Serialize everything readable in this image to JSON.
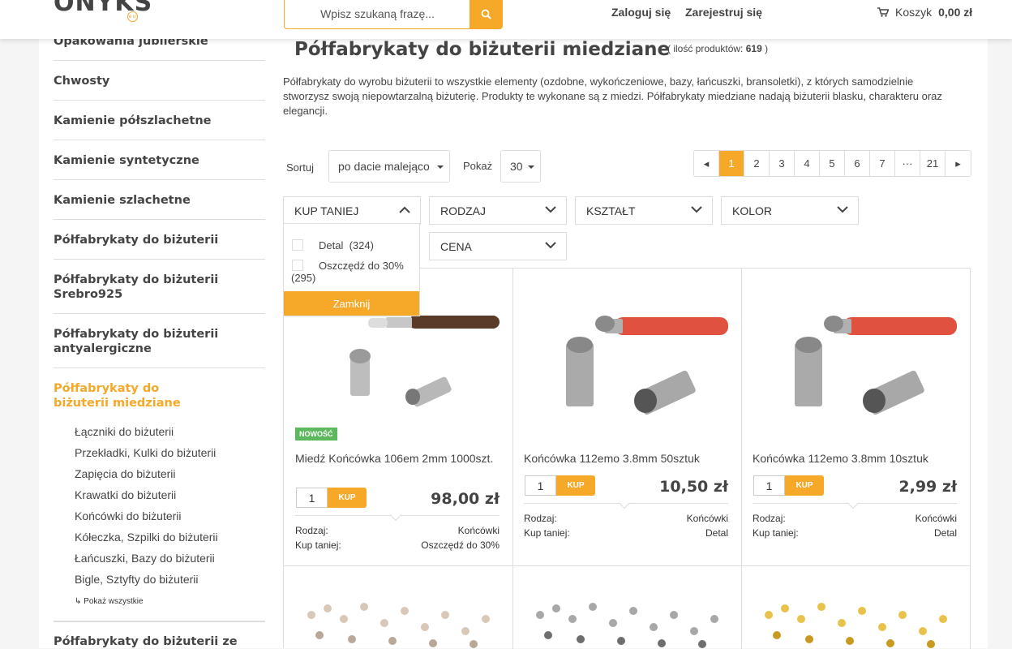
{
  "header": {
    "logo_text": "ONYKS",
    "logo_sub": "eu",
    "search_placeholder": "Wpisz szukaną frazę...",
    "login": "Zaloguj się",
    "register": "Zarejestruj się",
    "cart_label": "Koszyk",
    "cart_total": "0,00 zł"
  },
  "sidebar": {
    "categories": [
      "Opakowania jubilerskie",
      "Chwosty",
      "Kamienie półszlachetne",
      "Kamienie syntetyczne",
      "Kamienie szlachetne",
      "Półfabrykaty do biżuterii",
      "Półfabrykaty do biżuterii Srebro925",
      "Półfabrykaty do biżuterii antyalergiczne",
      "Półfabrykaty do biżuterii miedziane",
      "Półfabrykaty do biżuterii ze stali"
    ],
    "subcategories": [
      "Łączniki do biżuterii",
      "Przekładki, Kulki do biżuterii",
      "Zapięcia do biżuterii",
      "Krawatki do biżuterii",
      "Końcówki do biżuterii",
      "Kółeczka, Szpilki do biżuterii",
      "Łańcuszki, Bazy do biżuterii",
      "Bigle, Sztyfty do biżuterii"
    ],
    "show_all": "↳ Pokaż wszystkie"
  },
  "main": {
    "title": "Półfabrykaty do biżuterii miedziane",
    "count_prefix": "( ilość produktów:",
    "count_value": "619",
    "count_suffix": ")",
    "description": "Półfabrykaty do wyrobu biżuterii to wszystkie elementy (ozdobne, wykończeniowe, bazy, łańcuszki, bransoletki), z których samodzielnie stworzysz swoją niepowtarzalną biżuterię. Produkty te wykonane są z miedzi. Półfabrykaty miedziane nadają biżuterii blasku, charakteru oraz elegancji.",
    "sort_label": "Sortuj",
    "sort_value": "po dacie malejąco",
    "show_label": "Pokaż",
    "show_value": "30"
  },
  "pagination": [
    "◂",
    "1",
    "2",
    "3",
    "4",
    "5",
    "6",
    "7",
    "···",
    "21",
    "▸"
  ],
  "filters": {
    "kup_taniej": "KUP TANIEJ",
    "rodzaj": "RODZAJ",
    "ksztalt": "KSZTAŁT",
    "kolor": "KOLOR",
    "cena": "CENA",
    "options": [
      {
        "label": "Detal",
        "count": "(324)"
      },
      {
        "label": "Oszczędź do 30%",
        "count": "(295)"
      }
    ],
    "close": "Zamknij"
  },
  "products": [
    {
      "badge": "NOWOŚĆ",
      "name": "Miedź Końcówka 106em 2mm 1000szt.",
      "qty": "1",
      "buy": "KUP",
      "price": "98,00 zł",
      "attr_labels": [
        "Rodzaj:",
        "Kup taniej:"
      ],
      "attr_values": [
        "Końcówki",
        "Oszczędź do 30%"
      ]
    },
    {
      "name": "Końcówka 112emo 3.8mm 50sztuk",
      "qty": "1",
      "buy": "KUP",
      "price": "10,50 zł",
      "attr_labels": [
        "Rodzaj:",
        "Kup taniej:"
      ],
      "attr_values": [
        "Końcówki",
        "Detal"
      ]
    },
    {
      "name": "Końcówka 112emo 3.8mm 10sztuk",
      "qty": "1",
      "buy": "KUP",
      "price": "2,99 zł",
      "attr_labels": [
        "Rodzaj:",
        "Kup taniej:"
      ],
      "attr_values": [
        "Końcówki",
        "Detal"
      ]
    }
  ],
  "colors": {
    "accent": "#f6a828",
    "badge": "#5cb85c",
    "text": "#444444"
  }
}
